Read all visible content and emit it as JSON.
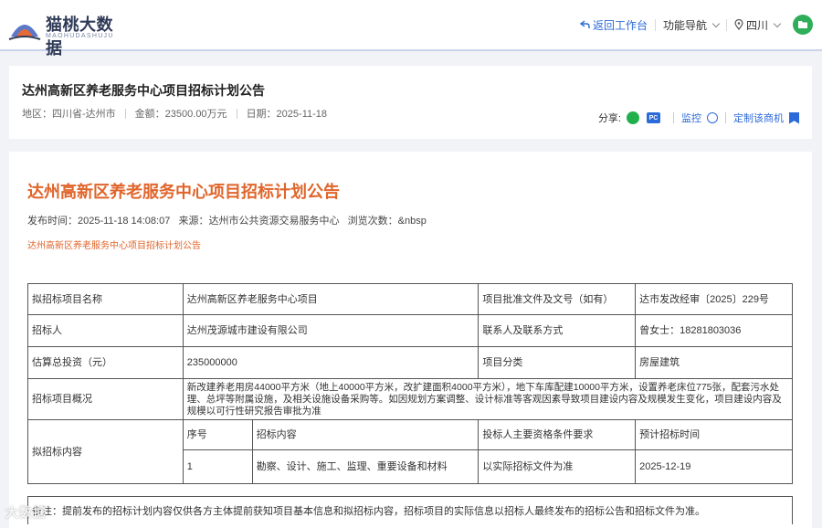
{
  "header": {
    "logo_text": "猫桃大数据",
    "logo_sub": "MAOHUDASHUJU",
    "back_label": "返回工作台",
    "nav_label": "功能导航",
    "region_label": "四川"
  },
  "summary": {
    "title": "达州高新区养老服务中心项目招标计划公告",
    "region": "地区：四川省-达州市",
    "amount": "金额：23500.00万元",
    "date": "日期：2025-11-18",
    "share_label": "分享:",
    "pc_label": "PC",
    "monitor_label": "监控",
    "subscribe_label": "定制该商机"
  },
  "article": {
    "title": "达州高新区养老服务中心项目招标计划公告",
    "meta": "发布时间：2025-11-18 14:08:07   来源：达州市公共资源交易服务中心   浏览次数：&nbsp",
    "subtitle": "达州高新区养老服务中心项目招标计划公告"
  },
  "table": {
    "r1": {
      "k1": "拟招标项目名称",
      "v1": "达州高新区养老服务中心项目",
      "k2": "项目批准文件及文号（如有）",
      "v2": "达市发改经审〔2025〕229号"
    },
    "r2": {
      "k1": "招标人",
      "v1": "达州茂源城市建设有限公司",
      "k2": "联系人及联系方式",
      "v2": "曾女士：18281803036"
    },
    "r3": {
      "k1": "估算总投资（元）",
      "v1": "235000000",
      "k2": "项目分类",
      "v2": "房屋建筑"
    },
    "r4": {
      "k1": "招标项目概况",
      "v1": "新改建养老用房44000平方米（地上40000平方米，改扩建面积4000平方米），地下车库配建10000平方米，设置养老床位775张，配套污水处理、总坪等附属设施，及相关设施设备采购等。如因规划方案调整、设计标准等客观因素导致项目建设内容及规模发生变化，项目建设内容及规模以可行性研究报告审批为准"
    },
    "r5": {
      "k1": "拟招标内容",
      "h_no": "序号",
      "h_content": "招标内容",
      "h_req": "投标人主要资格条件要求",
      "h_time": "预计招标时间"
    },
    "r6": {
      "no": "1",
      "content": "勘察、设计、施工、监理、重要设备和材料",
      "req": "以实际招标文件为准",
      "time": "2025-12-19"
    }
  },
  "footnote": "备注：提前发布的招标计划内容仅供各方主体提前获知项目基本信息和拟招标内容，招标项目的实际信息以招标人最终发布的招标公告和招标文件为准。",
  "watermark": "大数据"
}
